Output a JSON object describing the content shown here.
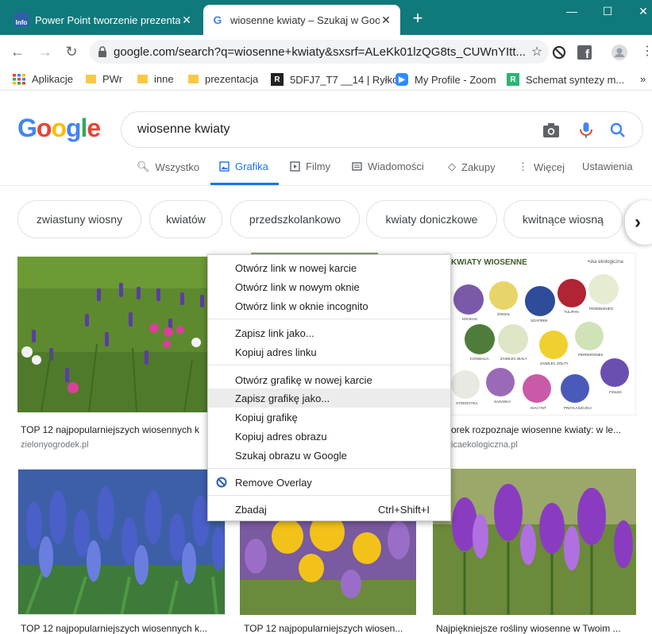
{
  "browser": {
    "tabs": [
      {
        "title": "Power Point tworzenie prezentac",
        "favicon": "info-favicon",
        "active": false
      },
      {
        "title": "wiosenne kwiaty – Szukaj w Goog",
        "favicon": "google-favicon",
        "active": true
      }
    ],
    "new_tab": "+",
    "window_controls": {
      "minimize": "—",
      "maximize": "☐",
      "close": "✕"
    },
    "url": "google.com/search?q=wiosenne+kwiaty&sxsrf=ALeKk01lzQG8ts_CUWnYItt..."
  },
  "bookmarks": [
    {
      "label": "Aplikacje",
      "icon": "apps-grid-icon"
    },
    {
      "label": "PWr",
      "icon": "folder-icon"
    },
    {
      "label": "inne",
      "icon": "folder-icon"
    },
    {
      "label": "prezentacja",
      "icon": "folder-icon"
    },
    {
      "label": "5DFJ7_T7 __14 | Ryłko",
      "icon": "r-icon"
    },
    {
      "label": "My Profile - Zoom",
      "icon": "zoom-icon"
    },
    {
      "label": "Schemat syntezy m...",
      "icon": "r-icon"
    }
  ],
  "bookmarks_more": "»",
  "google": {
    "logo": [
      "G",
      "o",
      "o",
      "g",
      "l",
      "e"
    ],
    "query": "wiosenne kwiaty",
    "tabs": [
      {
        "label": "Wszystko",
        "icon": "search-icon"
      },
      {
        "label": "Grafika",
        "icon": "image-icon"
      },
      {
        "label": "Filmy",
        "icon": "play-icon"
      },
      {
        "label": "Wiadomości",
        "icon": "news-icon"
      },
      {
        "label": "Zakupy",
        "icon": "tag-icon"
      },
      {
        "label": "Więcej",
        "icon": "more-vert-icon"
      }
    ],
    "settings_label": "Ustawienia",
    "chips": [
      "zwiastuny wiosny",
      "kwiatów",
      "przedszkolankowo",
      "kwiaty doniczkowe",
      "kwitnące wiosną"
    ]
  },
  "results": [
    {
      "caption": "TOP 12 najpopularniejszych wiosennych k",
      "source": "zielonyogrodek.pl"
    },
    {
      "caption": "orek rozpoznaje wiosenne kwiaty: w le...",
      "source": "icaekologiczna.pl",
      "image_title": "KWIATY WIOSENNE",
      "image_brand": "•ska ekologiczna",
      "image_labels": [
        "KROKUS",
        "ŻONKIL",
        "SZAFIREK",
        "TULIPAN",
        "PRZEBIŚNIEG",
        "KONWALIA",
        "ZAWILEC BIAŁY",
        "ZAWILEC ŻÓŁTY",
        "PIERWIOSNEK",
        "STOKROTKA",
        "SASANKA",
        "HIACYNT",
        "PRZYLASZCZKA",
        "FIOŁEK"
      ]
    },
    {
      "caption": "TOP 12 najpopularniejszych wiosennych k...",
      "source": ""
    },
    {
      "caption": "TOP 12 najpopularniejszych wiosen...",
      "source": ""
    },
    {
      "caption": "Najpiękniejsze rośliny wiosenne w Twoim ...",
      "source": ""
    }
  ],
  "context_menu": {
    "items": [
      "Otwórz link w nowej karcie",
      "Otwórz link w nowym oknie",
      "Otwórz link w oknie incognito",
      "Zapisz link jako...",
      "Kopiuj adres linku",
      "Otwórz grafikę w nowej karcie",
      "Zapisz grafikę jako...",
      "Kopiuj grafikę",
      "Kopiuj adres obrazu",
      "Szukaj obrazu w Google",
      "Remove Overlay",
      "Zbadaj"
    ],
    "inspect_shortcut": "Ctrl+Shift+I",
    "highlighted_item": "Zapisz grafikę jako..."
  },
  "colors": {
    "tabbar": "#10797c",
    "google_blue": "#4285f4",
    "google_red": "#ea4335",
    "google_yellow": "#fbbc05",
    "google_green": "#34a853",
    "active_tab": "#1a73e8"
  }
}
